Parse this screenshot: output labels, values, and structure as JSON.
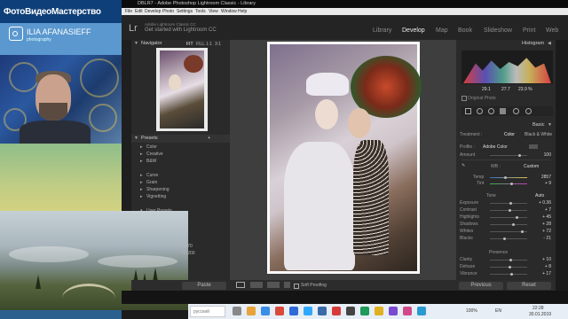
{
  "promo": {
    "brand": "ФотоВидеоМастерство",
    "author_name": "ILIA AFANASIEFF",
    "author_sub": "photography"
  },
  "window": {
    "title": "DBLR7 - Adobe Photoshop Lightroom Classic - Library",
    "menu": [
      "File",
      "Edit",
      "Develop",
      "Photo",
      "Settings",
      "Tools",
      "View",
      "Window",
      "Help"
    ]
  },
  "lightroom": {
    "logo": "Lr",
    "sub1": "Adobe Lightroom Classic CC",
    "sub2": "Get started with Lightroom CC",
    "modules": [
      "Library",
      "Develop",
      "Map",
      "Book",
      "Slideshow",
      "Print",
      "Web"
    ],
    "active_module": "Develop"
  },
  "left_panel": {
    "navigator_title": "Navigator",
    "navigator_zoom": [
      "FIT",
      "FILL",
      "1:1",
      "3:1"
    ],
    "presets_title": "Presets",
    "presets_group1": [
      "Color",
      "Creative",
      "B&W"
    ],
    "presets_group2": [
      "Curve",
      "Grain",
      "Sharpening",
      "Vignetting"
    ],
    "user_presets": "User Presets",
    "landscape_labels": [
      "24-70",
      "70-200"
    ],
    "paste": "Paste"
  },
  "center": {
    "soft_proofing": "Soft Proofing"
  },
  "right_panel": {
    "histogram_title": "Histogram",
    "histo_values": [
      "29.1",
      "27.7",
      "23.9 %"
    ],
    "original_photo": "Original Photo",
    "basic_title": "Basic",
    "treatment_label": "Treatment :",
    "treatment_color": "Color",
    "treatment_bw": "Black & White",
    "profile_label": "Profile :",
    "profile_value": "Adobe Color",
    "amount_label": "Amount",
    "amount_value": "100",
    "wb_label": "WB :",
    "wb_value": "Custom",
    "temp_label": "Temp",
    "temp_value": "2857",
    "tint_label": "Tint",
    "tint_value": "+ 9",
    "tone_label": "Tone",
    "auto_label": "Auto",
    "tone_rows": [
      {
        "label": "Exposure",
        "value": "+ 0.36",
        "level": 0.55
      },
      {
        "label": "Contrast",
        "value": "+ 7",
        "level": 0.53
      },
      {
        "label": "Highlights",
        "value": "+ 45",
        "level": 0.72
      },
      {
        "label": "Shadows",
        "value": "+ 28",
        "level": 0.64
      },
      {
        "label": "Whites",
        "value": "+ 72",
        "level": 0.86
      },
      {
        "label": "Blacks",
        "value": "- 21",
        "level": 0.4
      }
    ],
    "presence_title": "Presence",
    "presence_rows": [
      {
        "label": "Clarity",
        "value": "+ 10",
        "level": 0.55
      },
      {
        "label": "Dehaze",
        "value": "+ 8",
        "level": 0.54
      },
      {
        "label": "Vibrance",
        "value": "+ 17",
        "level": 0.58
      }
    ],
    "previous": "Previous",
    "reset": "Reset"
  },
  "taskbar": {
    "search_text": "русский",
    "lang": "EN",
    "time": "22:28",
    "date": "30.01.2019",
    "battery": "100%"
  }
}
